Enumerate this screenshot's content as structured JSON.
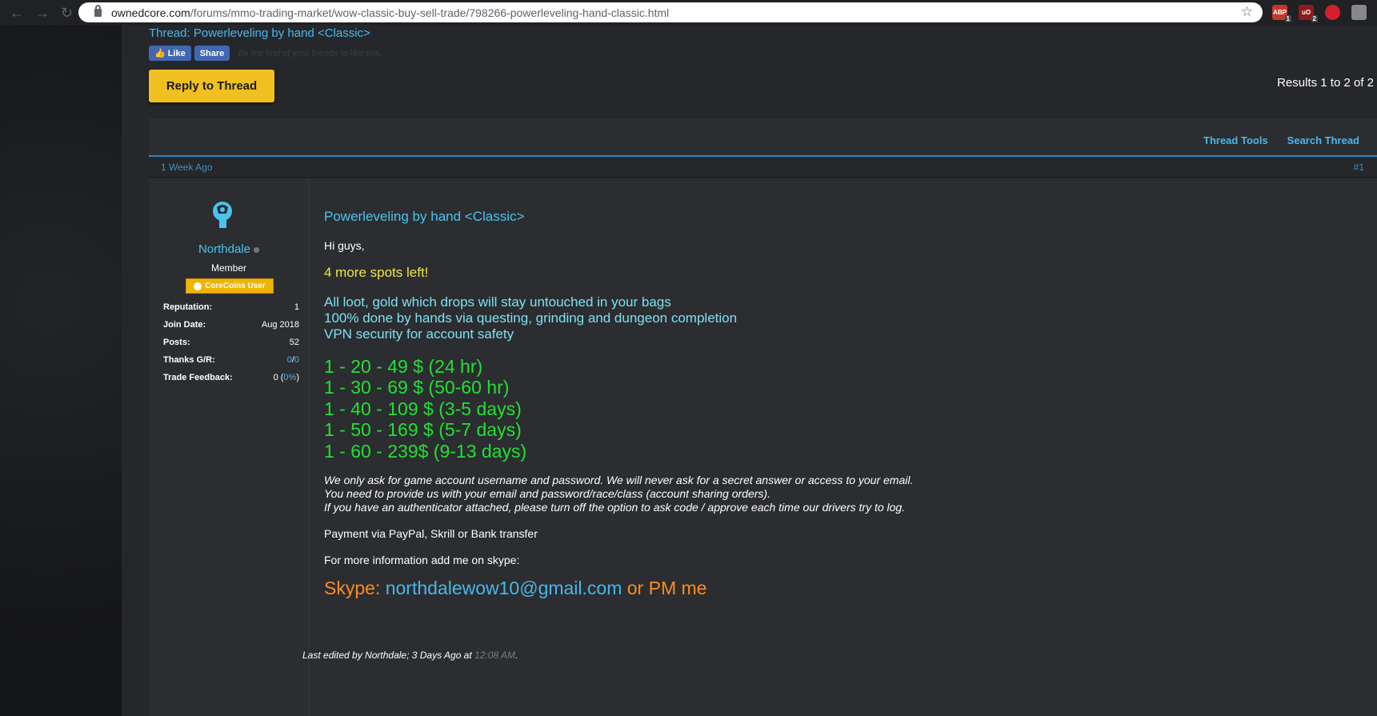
{
  "browser": {
    "url_host": "ownedcore.com",
    "url_path": "/forums/mmo-trading-market/wow-classic-buy-sell-trade/798266-powerleveling-hand-classic.html",
    "ext_badges": [
      "1",
      "2"
    ]
  },
  "thread": {
    "title": "Thread: Powerleveling by hand <Classic>",
    "like_label": "Like",
    "share_label": "Share",
    "fb_note": "Be the first of your friends to like this.",
    "reply_label": "Reply to Thread",
    "results": "Results 1 to 2 of 2",
    "tools": {
      "thread_tools": "Thread Tools",
      "search_thread": "Search Thread"
    }
  },
  "post": {
    "date": "1 Week Ago",
    "number": "#1",
    "user": {
      "name": "Northdale",
      "title": "Member",
      "badge": "CoreCoins User",
      "stats": [
        {
          "label": "Reputation:",
          "value": "1"
        },
        {
          "label": "Join Date:",
          "value": "Aug 2018"
        },
        {
          "label": "Posts:",
          "value": "52"
        },
        {
          "label": "Thanks G/R:",
          "value_a": "0",
          "sep": "/",
          "value_b": "0"
        },
        {
          "label": "Trade Feedback:",
          "value": "0 (",
          "value_b": "0%",
          "value_c": ")"
        }
      ]
    },
    "title": "Powerleveling by hand <Classic>",
    "greeting": "Hi guys,",
    "spots": "4 more spots left!",
    "features": [
      "All loot, gold which drops will stay untouched in your bags",
      "100% done by hands via questing, grinding and dungeon completion",
      "VPN security for account safety"
    ],
    "prices": [
      "1 - 20 - 49 $ (24 hr)",
      "1 - 30 - 69 $ (50-60 hr)",
      "1 - 40 - 109 $ (3-5 days)",
      "1 - 50 - 169 $ (5-7 days)",
      "1 - 60 - 239$ (9-13 days)"
    ],
    "notes": [
      "We only ask for game account username and password. We will never ask for a secret answer or access to your email.",
      "You need to provide us with your email and password/race/class (account sharing orders).",
      "If you have an authenticator attached, please turn off the option to ask code / approve each time our drivers try to log."
    ],
    "payment": "Payment via PayPal, Skrill or Bank transfer",
    "more_info": "For more information add me on skype:",
    "skype_label": "Skype: ",
    "skype_email": "northdalewow10@gmail.com",
    "skype_suffix": " or PM me",
    "edited_prefix": "Last edited by Northdale; 3 Days Ago at ",
    "edited_time": "12:08 AM",
    "edited_suffix": "."
  }
}
